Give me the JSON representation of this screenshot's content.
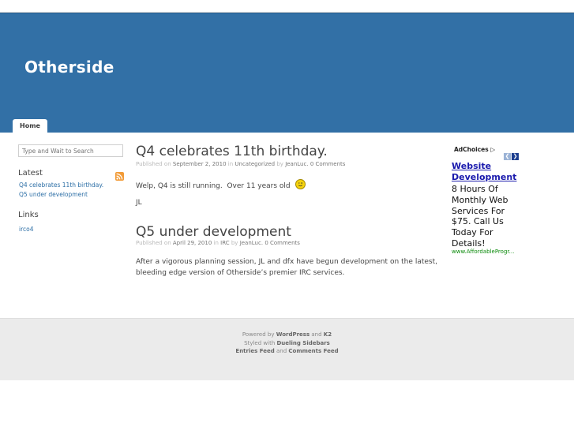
{
  "blog": {
    "title": "Otherside"
  },
  "nav": {
    "tabs": [
      {
        "label": "Home"
      }
    ]
  },
  "sidebar": {
    "search_placeholder": "Type and Wait to Search",
    "latest_heading": "Latest",
    "latest_items": [
      "Q4 celebrates 11th birthday.",
      "Q5 under development"
    ],
    "links_heading": "Links",
    "links": [
      "irco4"
    ],
    "feed_icon": "rss-icon"
  },
  "posts": [
    {
      "title": "Q4 celebrates 11th birthday.",
      "meta_published": "Published on",
      "date": "September 2, 2010",
      "in": "in",
      "category": "Uncategorized",
      "by": "by",
      "author": "JeanLuc.",
      "comments": "0 Comments",
      "body": [
        "Welp, Q4 is still running.  Over 11 years old",
        "JL"
      ],
      "emoticon": "wink-smiley-icon"
    },
    {
      "title": "Q5 under development",
      "meta_published": "Published on",
      "date": "April 29, 2010",
      "in": "in",
      "category": "IRC",
      "by": "by",
      "author": "JeanLuc.",
      "comments": "0 Comments",
      "body": [
        "After a vigorous planning session, JL and dfx have begun development on the latest, bleeding edge version of Otherside’s premier IRC services."
      ]
    }
  ],
  "ad": {
    "adchoices_label": "AdChoices",
    "title": "Website Development",
    "body": "8 Hours Of Monthly Web Services For $75. Call Us Today For Details!",
    "url": "www.AffordableProgr..."
  },
  "footer": {
    "powered_by": "Powered by",
    "wordpress": "WordPress",
    "and1": "and",
    "k2": "K2",
    "styled_with": "Styled with",
    "style_name": "Dueling Sidebars",
    "entries_feed": "Entries Feed",
    "and2": "and",
    "comments_feed": "Comments Feed"
  },
  "colors": {
    "header": "#3270a6",
    "link": "#2d6fa6",
    "footer_bg": "#ebebeb",
    "ad_title": "#1a1aad",
    "ad_url": "#0a8a0a"
  }
}
